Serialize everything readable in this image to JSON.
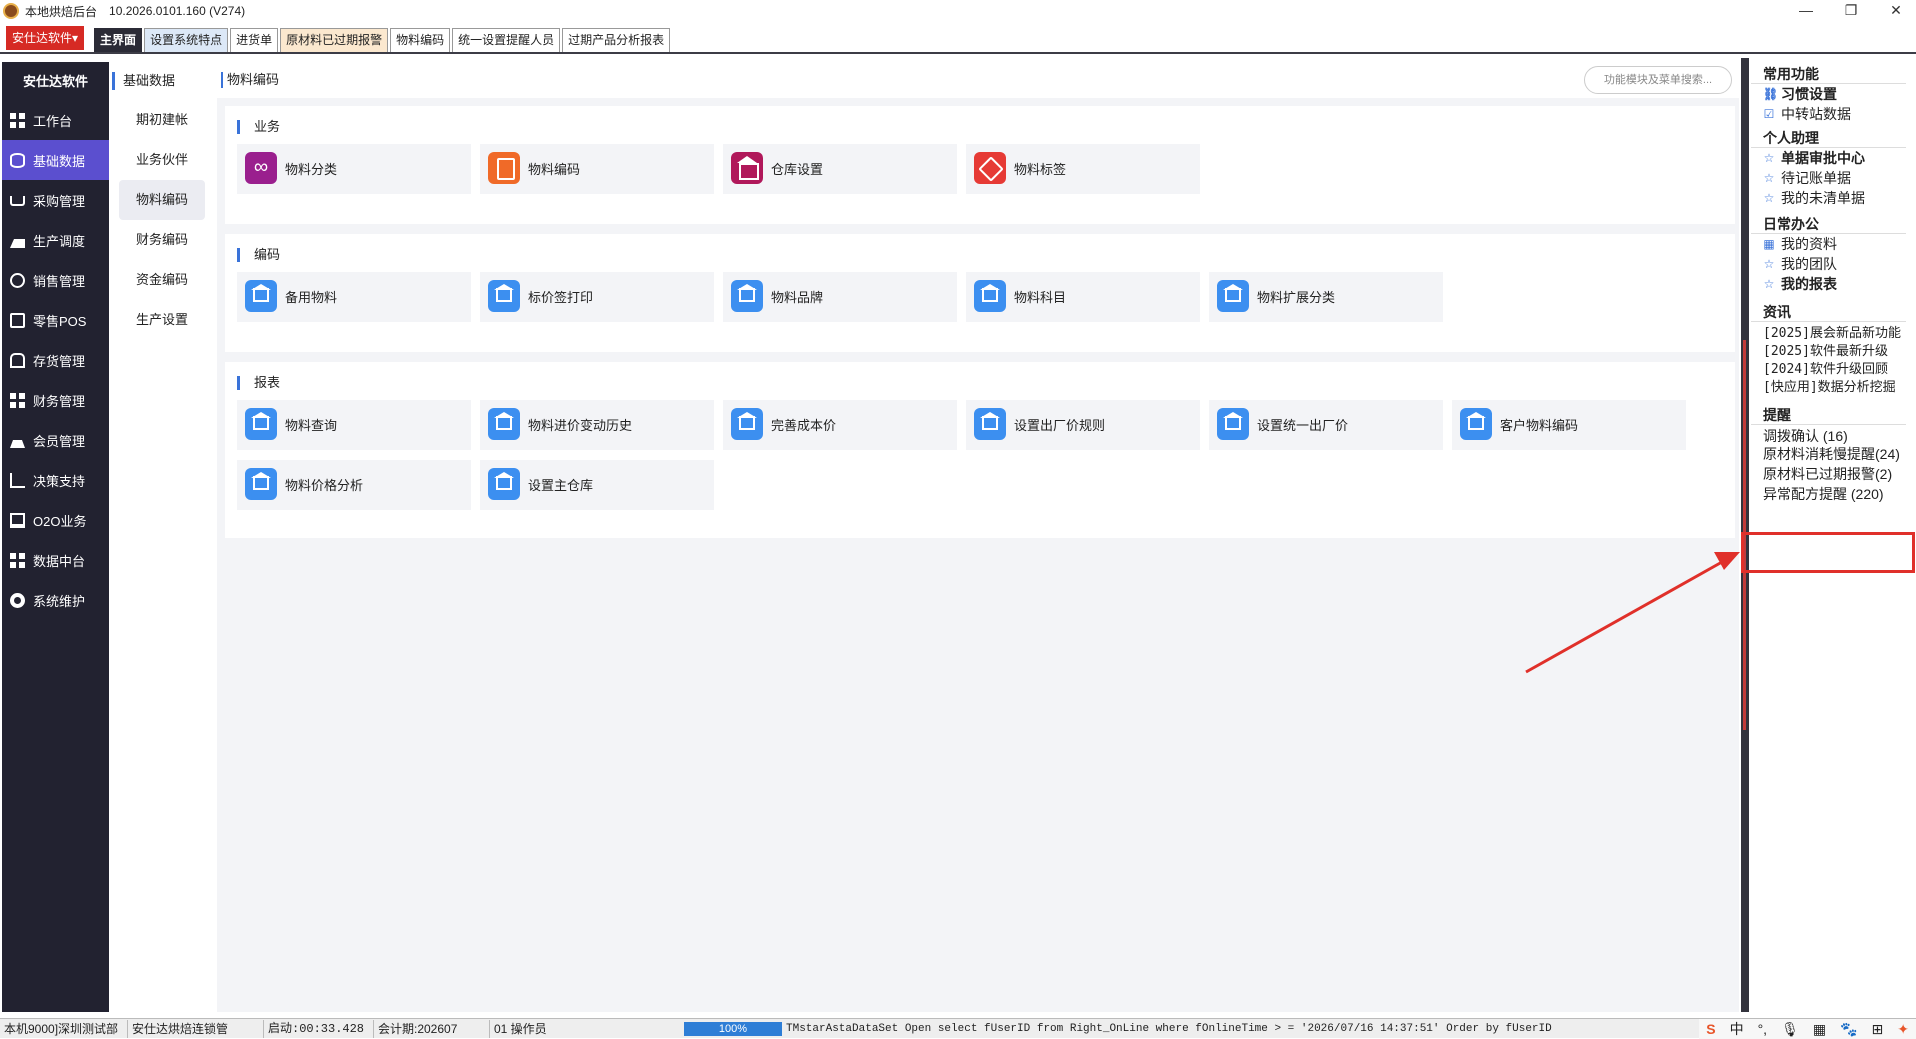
{
  "window": {
    "app_name": "本地烘焙后台",
    "version": "10.2026.0101.160 (V274)",
    "minimize": "—",
    "maximize": "❐",
    "close": "✕"
  },
  "tabbar": {
    "company": "安仕达软件",
    "tabs": [
      "主界面",
      "设置系统特点",
      "进货单",
      "原材料已过期报警",
      "物料编码",
      "统一设置提醒人员",
      "过期产品分析报表"
    ]
  },
  "nav": {
    "header": "安仕达软件",
    "items": [
      {
        "label": "工作台",
        "icon": "grid-icon"
      },
      {
        "label": "基础数据",
        "icon": "database-icon"
      },
      {
        "label": "采购管理",
        "icon": "cart-icon"
      },
      {
        "label": "生产调度",
        "icon": "factory-icon"
      },
      {
        "label": "销售管理",
        "icon": "sales-icon"
      },
      {
        "label": "零售POS",
        "icon": "pos-icon"
      },
      {
        "label": "存货管理",
        "icon": "warehouse-icon"
      },
      {
        "label": "财务管理",
        "icon": "grid-icon"
      },
      {
        "label": "会员管理",
        "icon": "crown-icon"
      },
      {
        "label": "决策支持",
        "icon": "chart-icon"
      },
      {
        "label": "O2O业务",
        "icon": "monitor-icon"
      },
      {
        "label": "数据中台",
        "icon": "grid-icon"
      },
      {
        "label": "系统维护",
        "icon": "gear-icon"
      }
    ]
  },
  "subnav": {
    "header": "基础数据",
    "items": [
      "期初建帐",
      "业务伙伴",
      "物料编码",
      "财务编码",
      "资金编码",
      "生产设置"
    ]
  },
  "content": {
    "breadcrumb": "物料编码",
    "search_placeholder": "功能模块及菜单搜索...",
    "sections": [
      {
        "title": "业务",
        "cards": [
          {
            "label": "物料分类",
            "icon": "category-icon"
          },
          {
            "label": "物料编码",
            "icon": "document-settings-icon"
          },
          {
            "label": "仓库设置",
            "icon": "warehouse-icon"
          },
          {
            "label": "物料标签",
            "icon": "tag-icon"
          }
        ]
      },
      {
        "title": "编码",
        "cards": [
          {
            "label": "备用物料",
            "icon": "home-search-icon"
          },
          {
            "label": "标价签打印",
            "icon": "home-search-icon"
          },
          {
            "label": "物料品牌",
            "icon": "home-search-icon"
          },
          {
            "label": "物料科目",
            "icon": "home-search-icon"
          },
          {
            "label": "物料扩展分类",
            "icon": "home-search-icon"
          }
        ]
      },
      {
        "title": "报表",
        "cards": [
          {
            "label": "物料查询",
            "icon": "home-search-icon"
          },
          {
            "label": "物料进价变动历史",
            "icon": "home-search-icon"
          },
          {
            "label": "完善成本价",
            "icon": "home-search-icon"
          },
          {
            "label": "设置出厂价规则",
            "icon": "home-search-icon"
          },
          {
            "label": "设置统一出厂价",
            "icon": "home-search-icon"
          },
          {
            "label": "客户物料编码",
            "icon": "home-search-icon"
          },
          {
            "label": "物料价格分析",
            "icon": "home-search-icon"
          },
          {
            "label": "设置主仓库",
            "icon": "home-search-icon"
          }
        ]
      }
    ]
  },
  "right_panel": {
    "common_title": "常用功能",
    "common": [
      {
        "label": "习惯设置",
        "icon": "link-icon",
        "bold": true
      },
      {
        "label": "中转站数据",
        "icon": "checkbox-icon",
        "bold": false
      }
    ],
    "assistant_title": "个人助理",
    "assistant": [
      {
        "label": "单据审批中心",
        "icon": "star-icon",
        "bold": true
      },
      {
        "label": "待记账单据",
        "icon": "star-icon",
        "bold": false
      },
      {
        "label": "我的未清单据",
        "icon": "star-icon",
        "bold": false
      }
    ],
    "office_title": "日常办公",
    "office": [
      {
        "label": "我的资料",
        "icon": "calendar-icon",
        "bold": false
      },
      {
        "label": "我的团队",
        "icon": "star-icon",
        "bold": false
      },
      {
        "label": "我的报表",
        "icon": "star-icon",
        "bold": true
      }
    ],
    "news_title": "资讯",
    "news": [
      "[2025]展会新品新功能",
      "[2025]软件最新升级",
      "[2024]软件升级回顾",
      "[快应用]数据分析挖掘"
    ],
    "remind_title": "提醒",
    "reminders": [
      "调拨确认 (16)",
      "原材料消耗慢提醒(24)",
      "原材料已过期报警(2)",
      "异常配方提醒 (220)"
    ]
  },
  "statusbar": {
    "cells": [
      "本机9000]深圳测试部",
      "安仕达烘焙连锁管",
      "启动:00:33.428",
      "会计期:202607",
      "01 操作员"
    ],
    "progress": "100%",
    "progress_value": 1.0,
    "sql": "TMstarAstaDataSet Open select fUserID from Right_OnLine where fOnlineTime > = '2026/07/16 14:37:51' Order by fUserID",
    "tray": [
      "S",
      "中",
      "°,",
      "🎙",
      "▦",
      "🐾",
      "⊞",
      "✦"
    ]
  }
}
